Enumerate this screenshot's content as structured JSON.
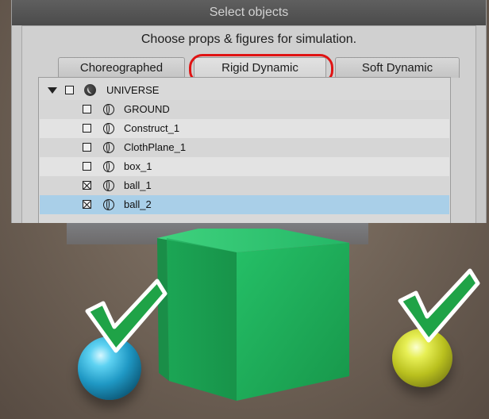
{
  "dialog": {
    "title": "Select objects",
    "subtitle": "Choose props & figures for simulation.",
    "tabs": [
      {
        "label": "Choreographed",
        "active": false
      },
      {
        "label": "Rigid Dynamic",
        "active": true,
        "highlighted": true
      },
      {
        "label": "Soft Dynamic",
        "active": false
      }
    ],
    "tree": {
      "root": {
        "label": "UNIVERSE",
        "expanded": true,
        "checked": false,
        "icon": "globe-icon"
      },
      "items": [
        {
          "label": "GROUND",
          "checked": false,
          "icon": "prop-icon",
          "selected": false
        },
        {
          "label": "Construct_1",
          "checked": false,
          "icon": "prop-icon",
          "selected": false
        },
        {
          "label": "ClothPlane_1",
          "checked": false,
          "icon": "prop-icon",
          "selected": false
        },
        {
          "label": "box_1",
          "checked": false,
          "icon": "prop-icon",
          "selected": false
        },
        {
          "label": "ball_1",
          "checked": true,
          "icon": "prop-icon",
          "selected": false
        },
        {
          "label": "ball_2",
          "checked": true,
          "icon": "prop-icon",
          "selected": true
        }
      ]
    }
  },
  "scene": {
    "objects": [
      {
        "name": "box",
        "color": "#19a651"
      },
      {
        "name": "ball-blue",
        "color": "#1f98c4",
        "marked": true
      },
      {
        "name": "ball-yellow",
        "color": "#b9c01e",
        "marked": true
      }
    ],
    "highlight_color": "#e01414",
    "checkmark_color": "#1fa347"
  }
}
